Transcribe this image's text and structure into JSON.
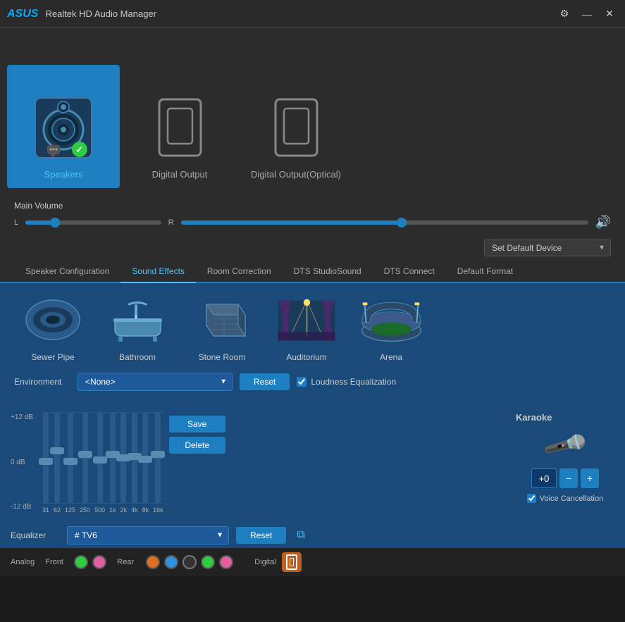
{
  "titleBar": {
    "logo": "ASUS",
    "title": "Realtek HD Audio Manager",
    "gearIcon": "⚙",
    "minimizeIcon": "—",
    "closeIcon": "✕"
  },
  "devices": [
    {
      "id": "speakers",
      "label": "Speakers",
      "active": true
    },
    {
      "id": "digital-output",
      "label": "Digital Output",
      "active": false
    },
    {
      "id": "digital-output-optical",
      "label": "Digital Output(Optical)",
      "active": false
    }
  ],
  "volume": {
    "label": "Main Volume",
    "leftLabel": "L",
    "rightLabel": "R",
    "speakerIcon": "🔊",
    "defaultDevice": "Set Default Device"
  },
  "tabs": [
    {
      "id": "speaker-config",
      "label": "Speaker Configuration",
      "active": false
    },
    {
      "id": "sound-effects",
      "label": "Sound Effects",
      "active": true
    },
    {
      "id": "room-correction",
      "label": "Room Correction",
      "active": false
    },
    {
      "id": "dts-studiosound",
      "label": "DTS StudioSound",
      "active": false
    },
    {
      "id": "dts-connect",
      "label": "DTS Connect",
      "active": false
    },
    {
      "id": "default-format",
      "label": "Default Format",
      "active": false
    }
  ],
  "soundEffects": {
    "envPresets": [
      {
        "id": "sewer-pipe",
        "label": "Sewer Pipe"
      },
      {
        "id": "bathroom",
        "label": "Bathroom"
      },
      {
        "id": "stone-room",
        "label": "Stone Room"
      },
      {
        "id": "auditorium",
        "label": "Auditorium"
      },
      {
        "id": "arena",
        "label": "Arena"
      }
    ],
    "environmentLabel": "Environment",
    "environmentValue": "<None>",
    "resetLabel": "Reset",
    "loudnessLabel": "Loudness Equalization"
  },
  "equalizer": {
    "label": "Equalizer",
    "preset": "# TV6",
    "resetLabel": "Reset",
    "saveLabel": "Save",
    "deleteLabel": "Delete",
    "dbLabels": [
      "+12 dB",
      "0 dB",
      "-12 dB"
    ],
    "bands": [
      {
        "freq": "31",
        "pos": 65
      },
      {
        "freq": "62",
        "pos": 50
      },
      {
        "freq": "125",
        "pos": 65
      },
      {
        "freq": "250",
        "pos": 55
      },
      {
        "freq": "500",
        "pos": 63
      },
      {
        "freq": "1k",
        "pos": 55
      },
      {
        "freq": "2k",
        "pos": 60
      },
      {
        "freq": "4k",
        "pos": 58
      },
      {
        "freq": "8k",
        "pos": 62
      },
      {
        "freq": "16k",
        "pos": 55
      }
    ]
  },
  "karaoke": {
    "label": "Karaoke",
    "value": "+0",
    "decreaseBtn": "−",
    "increaseBtn": "+",
    "voiceCancelLabel": "Voice Cancellation"
  },
  "bottomBar": {
    "analogLabel": "Analog",
    "frontLabel": "Front",
    "rearLabel": "Rear",
    "digitalLabel": "Digital",
    "connectors": {
      "front": [
        "green",
        "pink"
      ],
      "rear": [
        "orange",
        "blue",
        "black",
        "green2",
        "pink2"
      ]
    }
  }
}
